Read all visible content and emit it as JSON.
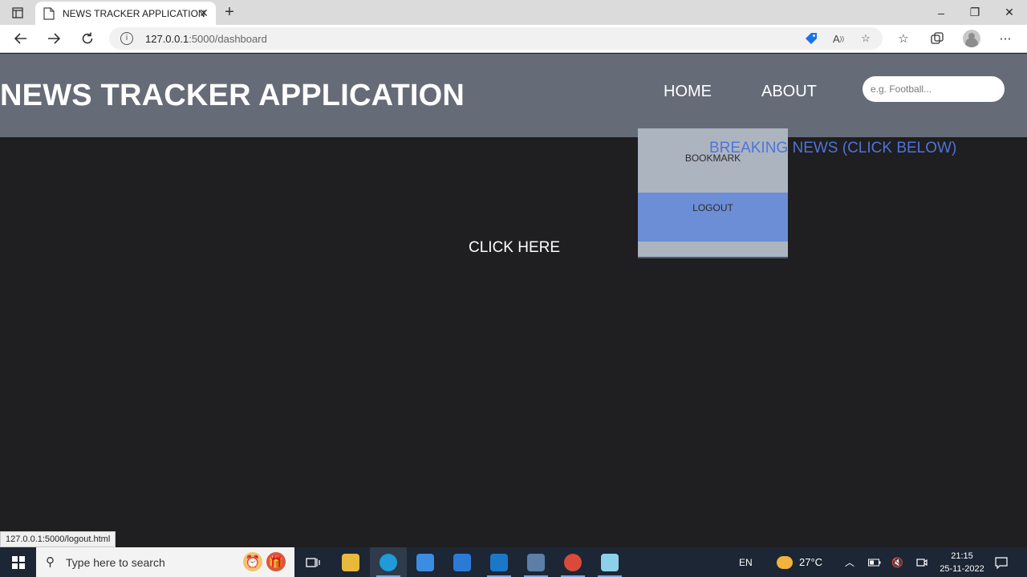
{
  "browser": {
    "tab_title": "NEWS TRACKER APPLICATION",
    "tab_close": "✕",
    "new_tab": "+",
    "url_host": "127.0.0.1",
    "url_rest": ":5000/dashboard",
    "window_controls": [
      "–",
      "❐",
      "✕"
    ]
  },
  "page": {
    "brand": "NEWS TRACKER APPLICATION",
    "nav": {
      "home": "HOME",
      "about": "ABOUT"
    },
    "search_placeholder": "e.g. Football...",
    "dropdown": {
      "bookmark": "BOOKMARK",
      "logout": "LOGOUT"
    },
    "breaking_news": "BREAKING NEWS (CLICK BELOW)",
    "click_here": "CLICK HERE"
  },
  "status_bar": {
    "hover_url": "127.0.0.1:5000/logout.html"
  },
  "taskbar": {
    "search_placeholder": "Type here to search",
    "language": "EN",
    "temperature": "27°C",
    "time": "21:15",
    "date": "25-11-2022"
  },
  "colors": {
    "header_bg": "#656c77",
    "page_bg": "#1f1e20",
    "dropdown_bg": "#acb4c0",
    "logout_highlight": "#6b8ed6",
    "breaking_news": "#4f74d8"
  }
}
